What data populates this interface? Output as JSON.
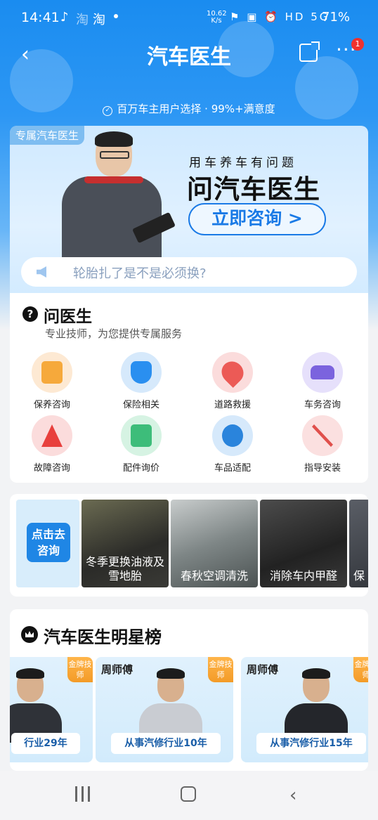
{
  "status_bar": {
    "time": "14:41",
    "app_icon_1": "淘",
    "app_icon_2": "淘",
    "net_speed": "10.62",
    "net_unit": "K/s",
    "icons": "⚑ ▣ ⏰ HD 5G",
    "battery": "71%"
  },
  "nav": {
    "title": "汽车医生",
    "back_glyph": "‹",
    "more_glyph": "···",
    "badge_count": "1"
  },
  "tagline": "百万车主用户选择 · 99%+满意度",
  "hero": {
    "tag": "专属汽车医生",
    "subtitle": "用车养车有问题",
    "title": "问汽车医生",
    "cta": "立即咨询 >",
    "search_placeholder": "轮胎扎了是不是必须换?"
  },
  "ask_doctor": {
    "icon_text": "?",
    "title": "问医生",
    "subtitle": "专业技师，为您提供专属服务",
    "services": [
      {
        "label": "保养咨询",
        "icon": "oil-can-icon",
        "color": "#f6a93b",
        "bg": "#fde9d3"
      },
      {
        "label": "保险相关",
        "icon": "shield-check-icon",
        "color": "#2a8ff0",
        "bg": "#d6e9fb"
      },
      {
        "label": "道路救援",
        "icon": "location-pin-icon",
        "color": "#ec5a56",
        "bg": "#fbdcdc"
      },
      {
        "label": "车务咨询",
        "icon": "car-icon",
        "color": "#7b63de",
        "bg": "#e6e0fb"
      },
      {
        "label": "故障咨询",
        "icon": "warning-icon",
        "color": "#e8403d",
        "bg": "#fbdcdc"
      },
      {
        "label": "配件询价",
        "icon": "price-tag-icon",
        "color": "#3dbd7a",
        "bg": "#d6f3e3"
      },
      {
        "label": "车品适配",
        "icon": "gear-icon",
        "color": "#2a84dc",
        "bg": "#d6e9fb"
      },
      {
        "label": "指导安装",
        "icon": "tools-icon",
        "color": "#e0504c",
        "bg": "#fbe0e0"
      }
    ]
  },
  "topics": {
    "cta": "点击去咨询",
    "items": [
      {
        "label": "冬季更换油液及雪地胎"
      },
      {
        "label": "春秋空调清洗"
      },
      {
        "label": "消除车内甲醛"
      },
      {
        "label": "保"
      }
    ]
  },
  "stars": {
    "title": "汽车医生明星榜",
    "techs": [
      {
        "name": "",
        "badge": "金牌技师",
        "experience": "行业29年"
      },
      {
        "name": "周师傅",
        "badge": "金牌技师",
        "experience": "从事汽修行业10年"
      },
      {
        "name": "周师傅",
        "badge": "金牌技师",
        "experience": "从事汽修行业15年"
      }
    ]
  },
  "bottom_nav": {
    "back_glyph": "‹"
  }
}
